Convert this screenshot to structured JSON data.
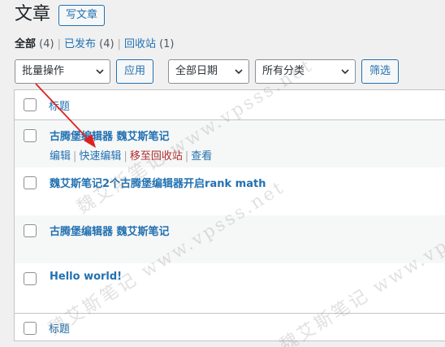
{
  "header": {
    "title": "文章",
    "add_new_label": "写文章"
  },
  "views": [
    {
      "label": "全部",
      "count": "(4)",
      "current": true
    },
    {
      "label": "已发布",
      "count": "(4)",
      "current": false
    },
    {
      "label": "回收站",
      "count": "(1)",
      "current": false
    }
  ],
  "filters": {
    "bulk_actions": "批量操作",
    "apply_label": "应用",
    "date_filter": "全部日期",
    "category_filter": "所有分类",
    "filter_label": "筛选"
  },
  "table": {
    "column_title": "标题",
    "rows": [
      {
        "title": "古腾堡编辑器 魏艾斯笔记",
        "actions": [
          "编辑",
          "快速编辑",
          "移至回收站",
          "查看"
        ]
      },
      {
        "title": "魏艾斯笔记2个古腾堡编辑器开启rank math"
      },
      {
        "title": "古腾堡编辑器 魏艾斯笔记"
      },
      {
        "title": "Hello world!"
      }
    ]
  },
  "watermarks": [
    "魏艾斯笔记 www.vpsss.net",
    "魏艾斯笔记 www.vpsss.net",
    "魏艾斯笔记 www.vpsss.net"
  ],
  "colors": {
    "link": "#2271b1",
    "trash": "#b32d2e",
    "annotation_arrow": "#e02020"
  }
}
